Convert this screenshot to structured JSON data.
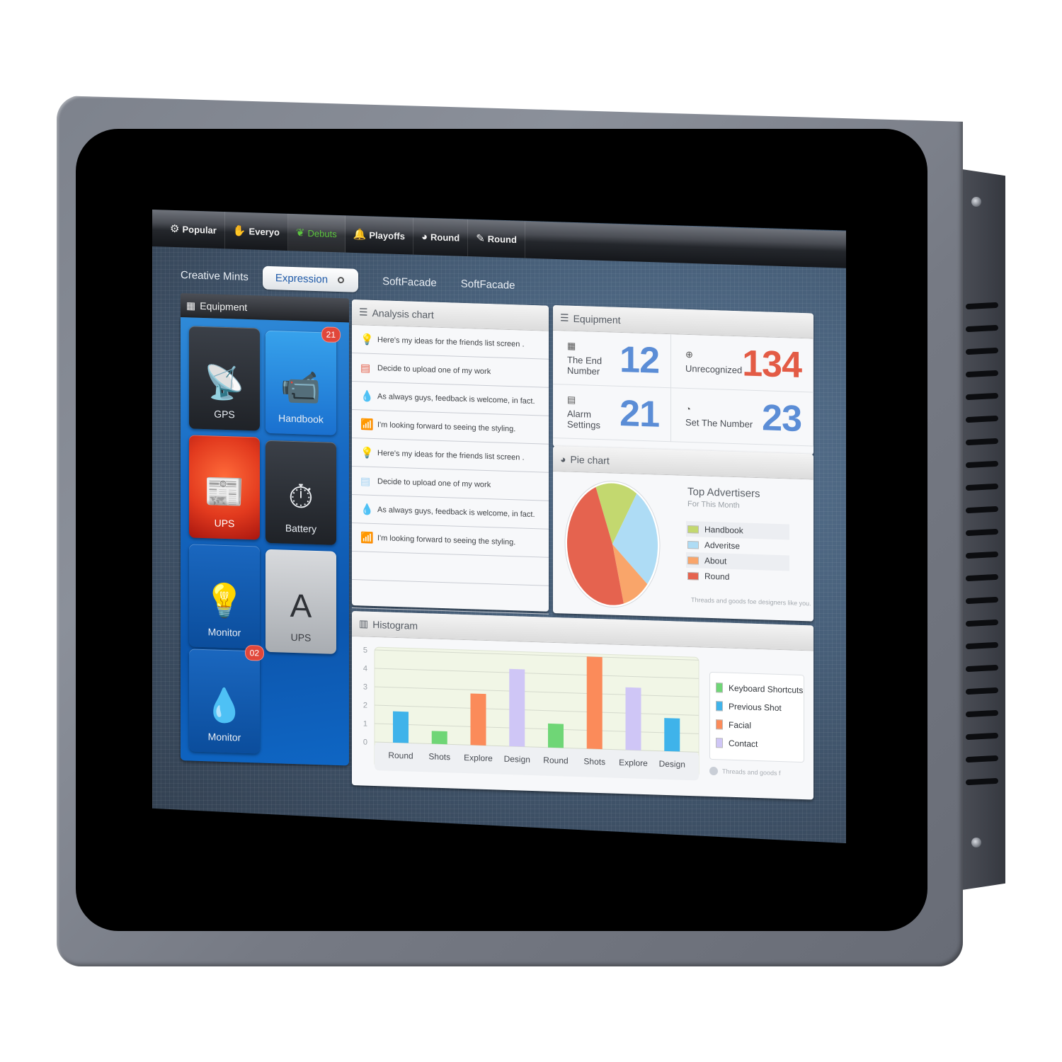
{
  "top_nav": [
    {
      "label": "Popular",
      "icon": "gear-icon",
      "glyph": "⚙",
      "active": false
    },
    {
      "label": "Everyo",
      "icon": "mouse-click-icon",
      "glyph": "✋",
      "active": false
    },
    {
      "label": "Debuts",
      "icon": "leaf-icon",
      "glyph": "❦",
      "active": true
    },
    {
      "label": "Playoffs",
      "icon": "bell-icon",
      "glyph": "🔔",
      "active": false
    },
    {
      "label": "Round",
      "icon": "globe-icon",
      "glyph": "◕",
      "active": false
    },
    {
      "label": "Round",
      "icon": "feather-icon",
      "glyph": "✎",
      "active": false
    }
  ],
  "sub_tabs": {
    "first": "Creative Mints",
    "selected": "Expression",
    "third": "SoftFacade",
    "fourth": "SoftFacade"
  },
  "equipment_tiles": {
    "title": "Equipment",
    "tiles": [
      {
        "label": "GPS",
        "icon": "satellite-dish-icon",
        "glyph": "📡",
        "badge": null,
        "style": "dark"
      },
      {
        "label": "Handbook",
        "icon": "security-camera-icon",
        "glyph": "📹",
        "badge": "21",
        "style": "blue"
      },
      {
        "label": "UPS",
        "icon": "newspaper-icon",
        "glyph": "📰",
        "badge": null,
        "style": "red"
      },
      {
        "label": "Battery",
        "icon": "stopwatch-icon",
        "glyph": "⏱",
        "badge": null,
        "style": "dark"
      },
      {
        "label": "Monitor",
        "icon": "lightbulb-icon",
        "glyph": "💡",
        "badge": null,
        "style": "navy"
      },
      {
        "label": "UPS",
        "icon": "font-a-icon",
        "glyph": "A",
        "badge": null,
        "style": "silver"
      },
      {
        "label": "Monitor",
        "icon": "water-drop-icon",
        "glyph": "💧",
        "badge": "02",
        "style": "navy"
      }
    ]
  },
  "analysis": {
    "title": "Analysis chart",
    "rows": [
      {
        "text": "Here's my ideas for the friends list screen .",
        "icon": "lightbulb-icon",
        "glyph": "💡",
        "color": "#e35b45"
      },
      {
        "text": "Decide to upload one of my work",
        "icon": "battery-icon",
        "glyph": "▤",
        "color": "#e35b45"
      },
      {
        "text": "As always guys, feedback is welcome, in fact.",
        "icon": "water-drop-icon",
        "glyph": "💧",
        "color": "#f6a25e"
      },
      {
        "text": "I'm looking forward to seeing the styling.",
        "icon": "broadcast-icon",
        "glyph": "📶",
        "color": "#f6a25e"
      },
      {
        "text": "Here's my ideas for the friends list screen .",
        "icon": "lightbulb-icon",
        "glyph": "💡",
        "color": "#f6a25e"
      },
      {
        "text": "Decide to upload one of my work",
        "icon": "battery-icon",
        "glyph": "▤",
        "color": "#9fd0f2"
      },
      {
        "text": "As always guys, feedback is welcome, in fact.",
        "icon": "water-drop-icon",
        "glyph": "💧",
        "color": "#a8c85a"
      },
      {
        "text": "I'm looking forward to seeing the styling.",
        "icon": "broadcast-icon",
        "glyph": "📶",
        "color": "#c4d86a"
      }
    ]
  },
  "stats": {
    "title": "Equipment",
    "cells": [
      {
        "label": "The End Number",
        "value": "12",
        "icon": "calendar-icon",
        "glyph": "▦",
        "color": "#5b8dd6"
      },
      {
        "label": "Unrecognized",
        "value": "134",
        "icon": "plus-circle-icon",
        "glyph": "⊕",
        "color": "#e35b45"
      },
      {
        "label": "Alarm Settings",
        "value": "21",
        "icon": "clipboard-icon",
        "glyph": "▤",
        "color": "#5b8dd6"
      },
      {
        "label": "Set The Number",
        "value": "23",
        "icon": "pie-icon",
        "glyph": "◔",
        "color": "#5b8dd6"
      }
    ]
  },
  "pie_panel": {
    "title": "Pie chart",
    "legend_title": "Top Advertisers",
    "legend_subtitle": "For This Month",
    "footer": "Threads and goods foe designers like you."
  },
  "histogram_panel": {
    "title": "Histogram",
    "footer": "Threads and goods f"
  },
  "chart_data": [
    {
      "type": "pie",
      "title": "Top Advertisers",
      "subtitle": "For This Month",
      "labels": [
        "Handbook",
        "Adveritse",
        "About",
        "Round"
      ],
      "values": [
        15,
        27,
        10,
        48
      ],
      "colors": [
        "#c3d86f",
        "#aedcf5",
        "#f9a56a",
        "#e5634f"
      ],
      "legend": "right"
    },
    {
      "type": "bar",
      "title": "Histogram",
      "categories": [
        "Round",
        "Shots",
        "Explore",
        "Design",
        "Round",
        "Shots",
        "Explore",
        "Design"
      ],
      "values": [
        1.7,
        0.7,
        2.8,
        4.2,
        1.3,
        5.0,
        3.4,
        1.8
      ],
      "bar_series": [
        "Previous Shot",
        "Keyboard Shortcuts",
        "Facial",
        "Contact",
        "Keyboard Shortcuts",
        "Facial",
        "Contact",
        "Previous Shot"
      ],
      "series": [
        {
          "name": "Keyboard Shortcuts",
          "color": "#6fd676"
        },
        {
          "name": "Previous Shot",
          "color": "#3fb3ea"
        },
        {
          "name": "Facial",
          "color": "#fb8b5a"
        },
        {
          "name": "Contact",
          "color": "#cfc6f6"
        }
      ],
      "yticks": [
        0,
        1,
        2,
        3,
        4,
        5
      ],
      "ylim": [
        0,
        5
      ],
      "grid": true,
      "legend": "right",
      "xlabel": "",
      "ylabel": ""
    }
  ]
}
